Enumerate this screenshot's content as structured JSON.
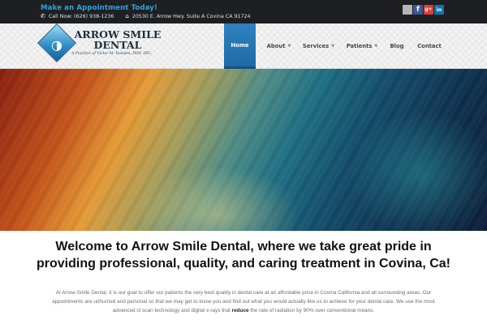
{
  "topbar": {
    "appointment_text": "Make an Appointment Today!",
    "phone_text": "Call Now: (626) 938-1236",
    "address_text": "20530 E. Arrow Hwy. Suite A Covina CA 91724",
    "phone_icon": "phone-icon",
    "address_icon": "home-icon",
    "social": {
      "facebook_glyph": "f",
      "googleplus_glyph": "g+",
      "linkedin_glyph": "in"
    }
  },
  "logo": {
    "name_line1": "ARROW SMILE",
    "name_line2": "DENTAL",
    "tagline": "A Practice of Victor M. Rosales, DDS, INC."
  },
  "nav": {
    "home": "Home",
    "about": "About",
    "services": "Services",
    "patients": "Patients",
    "blog": "Blog",
    "contact": "Contact",
    "caret": "▼"
  },
  "main": {
    "headline": "Welcome to Arrow Smile Dental, where we take great pride in providing professional, quality, and caring treatment in Covina, Ca!",
    "intro_before": "At Arrow Smile Dental, it is our goal to offer our patients the very best quality in dental care at an affordable price in Covina California and all surrounding areas. Our appointments are unhurried and personal so that we may get to know you and find out what you would actually like us to achieve for your dental care. We use the most advanced ct scan technology and digital x-rays that ",
    "intro_bold": "reduce",
    "intro_after": " the rate of radiation by 90% over conventional means."
  },
  "colors": {
    "accent": "#2fa3dc",
    "nav_active": "#2677b5",
    "topbar_bg": "#1d1f22"
  }
}
